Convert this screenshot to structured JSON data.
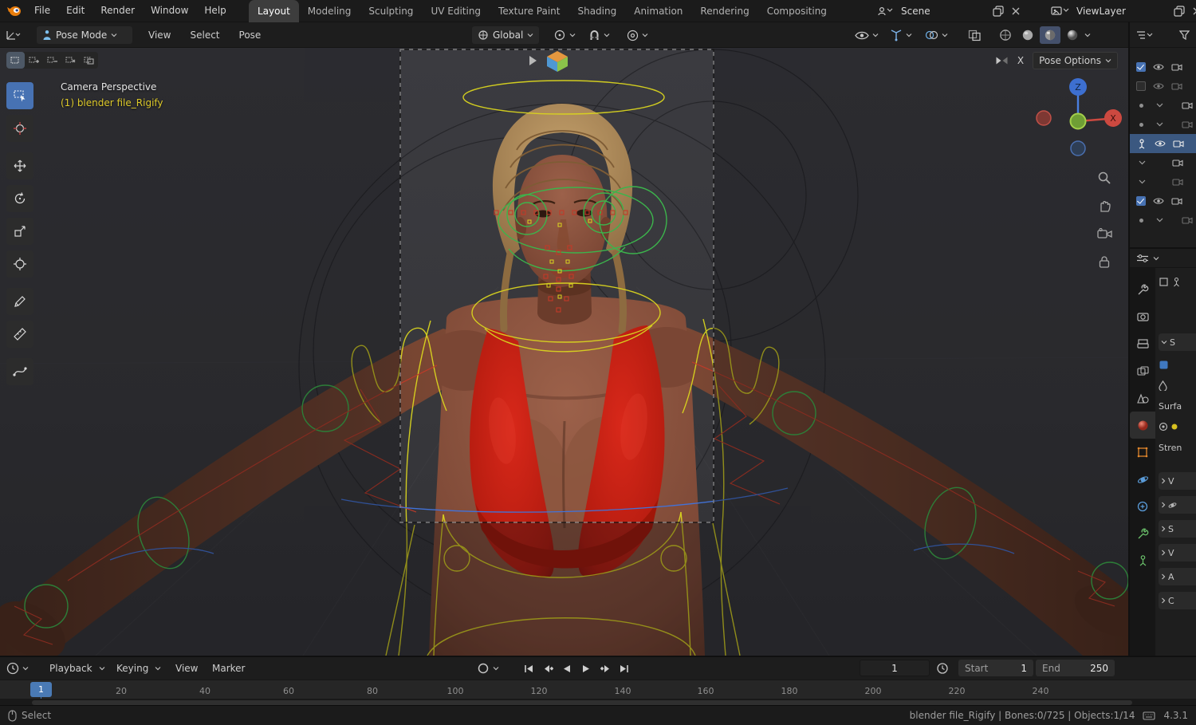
{
  "topbar": {
    "menus": [
      "File",
      "Edit",
      "Render",
      "Window",
      "Help"
    ],
    "workspaces": [
      {
        "label": "Layout",
        "active": true
      },
      {
        "label": "Modeling"
      },
      {
        "label": "Sculpting"
      },
      {
        "label": "UV Editing"
      },
      {
        "label": "Texture Paint"
      },
      {
        "label": "Shading"
      },
      {
        "label": "Animation"
      },
      {
        "label": "Rendering"
      },
      {
        "label": "Compositing"
      }
    ],
    "scene_name": "Scene",
    "viewlayer_name": "ViewLayer"
  },
  "viewport_header": {
    "mode": "Pose Mode",
    "menus": [
      "View",
      "Select",
      "Pose"
    ],
    "orientation": "Global"
  },
  "tool_settings": {
    "mirror_x_label": "X",
    "pose_options_label": "Pose Options"
  },
  "viewport": {
    "view_label": "Camera Perspective",
    "active_object_label": "(1) blender file_Rigify",
    "gizmo_z": "Z",
    "gizmo_x": "X"
  },
  "properties_panel": {
    "sections": [
      "S",
      "Surfa",
      "Stren",
      "V",
      "S",
      "V",
      "A",
      "C"
    ]
  },
  "timeline": {
    "playback_label": "Playback",
    "keying_label": "Keying",
    "view_label": "View",
    "marker_label": "Marker",
    "current_frame": "1",
    "playhead_label": "1",
    "start_label": "Start",
    "start_value": "1",
    "end_label": "End",
    "end_value": "250",
    "ticks": [
      "20",
      "40",
      "60",
      "80",
      "100",
      "120",
      "140",
      "160",
      "180",
      "200",
      "220",
      "240"
    ]
  },
  "status_bar": {
    "select_label": "Select",
    "info": "blender file_Rigify | Bones:0/725 | Objects:1/14",
    "version": "4.3.1"
  },
  "colors": {
    "accent": "#4772b3",
    "active_object_text": "#dcc829",
    "rig_yellow": "#d9d41f",
    "rig_green": "#3cb44c",
    "rig_red": "#c23a28",
    "rig_blue": "#4272d8"
  }
}
